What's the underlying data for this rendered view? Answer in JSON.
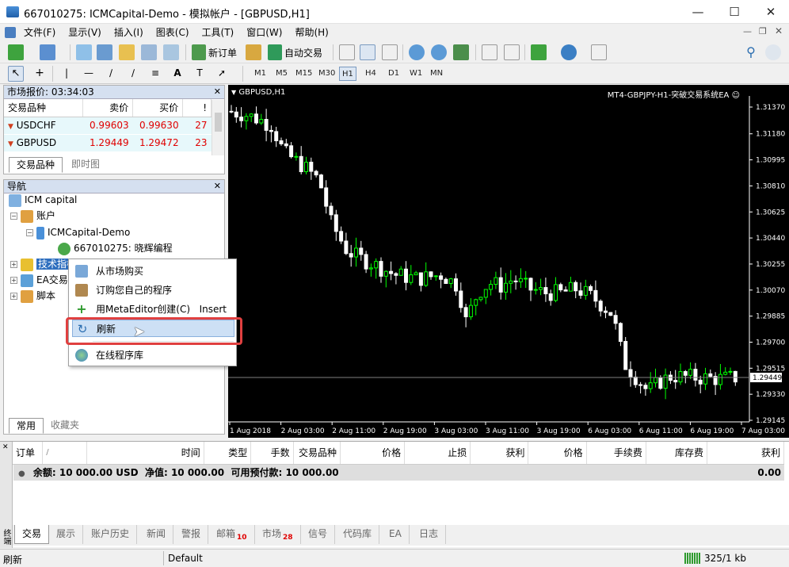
{
  "window": {
    "title": "667010275: ICMCapital-Demo - 模拟帐户 - [GBPUSD,H1]"
  },
  "menu": [
    "文件(F)",
    "显示(V)",
    "插入(I)",
    "图表(C)",
    "工具(T)",
    "窗口(W)",
    "帮助(H)"
  ],
  "toolbar": {
    "new_order": "新订单",
    "auto_trading": "自动交易"
  },
  "timeframes": [
    "M1",
    "M5",
    "M15",
    "M30",
    "H1",
    "H4",
    "D1",
    "W1",
    "MN"
  ],
  "market_watch": {
    "title": "市场报价: 03:34:03",
    "headers": [
      "交易品种",
      "卖价",
      "买价",
      "!"
    ],
    "rows": [
      {
        "symbol": "USDCHF",
        "bid": "0.99603",
        "ask": "0.99630",
        "spread": "27"
      },
      {
        "symbol": "GBPUSD",
        "bid": "1.29449",
        "ask": "1.29472",
        "spread": "23"
      }
    ],
    "tabs": [
      "交易品种",
      "即时图"
    ]
  },
  "navigator": {
    "title": "导航",
    "root": "ICM capital",
    "accounts": "账户",
    "server": "ICMCapital-Demo",
    "account": "667010275: 晓辉编程",
    "indicators": "技术指标",
    "experts": "EA交易",
    "scripts": "脚本",
    "tabs": [
      "常用",
      "收藏夹"
    ]
  },
  "context_menu": {
    "items": [
      {
        "label": "从市场购买",
        "shortcut": ""
      },
      {
        "label": "订购您自己的程序",
        "shortcut": ""
      },
      {
        "label": "用MetaEditor创建(C)",
        "shortcut": "Insert"
      },
      {
        "label": "刷新",
        "shortcut": ""
      },
      {
        "label": "在线程序库",
        "shortcut": ""
      }
    ]
  },
  "chart": {
    "symbol_label": "GBPUSD,H1",
    "ea_label": "MT4-GBPJPY-H1-突破交易系统EA",
    "current_price": "1.29449",
    "price_ticks": [
      "1.31370",
      "1.31180",
      "1.30995",
      "1.30810",
      "1.30625",
      "1.30440",
      "1.30255",
      "1.30070",
      "1.29885",
      "1.29700",
      "1.29515",
      "1.29330",
      "1.29145"
    ],
    "time_ticks": [
      "1 Aug 2018",
      "2 Aug 03:00",
      "2 Aug 11:00",
      "2 Aug 19:00",
      "3 Aug 03:00",
      "3 Aug 11:00",
      "3 Aug 19:00",
      "6 Aug 03:00",
      "6 Aug 11:00",
      "6 Aug 19:00",
      "7 Aug 03:00"
    ]
  },
  "terminal": {
    "side_label": "终端",
    "headers": [
      "订单",
      "/",
      "时间",
      "类型",
      "手数",
      "交易品种",
      "价格",
      "止损",
      "获利",
      "价格",
      "手续费",
      "库存费",
      "获利"
    ],
    "balance_text": "余额: 10 000.00 USD  净值: 10 000.00  可用预付款: 10 000.00",
    "balance_profit": "0.00",
    "tabs": [
      {
        "label": "交易",
        "badge": ""
      },
      {
        "label": "展示",
        "badge": ""
      },
      {
        "label": "账户历史",
        "badge": ""
      },
      {
        "label": "新闻",
        "badge": ""
      },
      {
        "label": "警报",
        "badge": ""
      },
      {
        "label": "邮箱",
        "badge": "10"
      },
      {
        "label": "市场",
        "badge": "28"
      },
      {
        "label": "信号",
        "badge": ""
      },
      {
        "label": "代码库",
        "badge": ""
      },
      {
        "label": "EA",
        "badge": ""
      },
      {
        "label": "日志",
        "badge": ""
      }
    ]
  },
  "status": {
    "left": "刷新",
    "profile": "Default",
    "traffic": "325/1 kb"
  },
  "colors": {
    "bull": "#00ff00",
    "bear": "#ffffff",
    "price_text": "#e00000",
    "highlight": "#e04040"
  }
}
